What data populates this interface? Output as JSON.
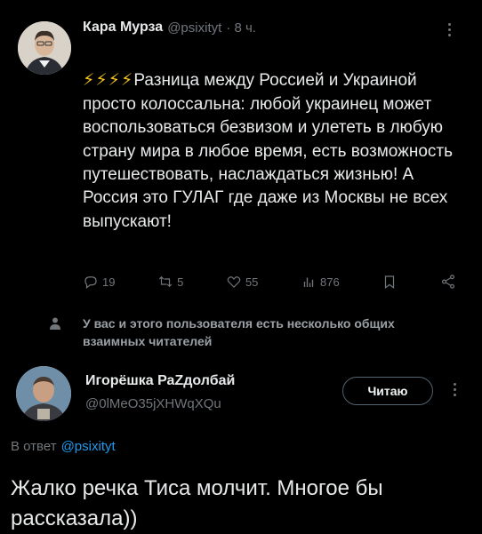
{
  "tweet": {
    "author_name": "Кара Мурза",
    "author_handle": "@psixityt",
    "time": "· 8 ч.",
    "lightning": "⚡⚡⚡⚡",
    "text": "Разница между Россией и Украиной просто колоссальна: любой украинец может воспользоваться безвизом и улететь в любую страну мира в любое время, есть возможность путешествовать, наслаждаться жизнью! А Россия это ГУЛАГ где даже из Москвы не всех выпускают!",
    "actions": {
      "replies": "19",
      "retweets": "5",
      "likes": "55",
      "views": "876"
    }
  },
  "mutual_notice": "У вас и этого пользователя есть несколько общих взаимных читателей",
  "user_card": {
    "name": "Игорёшка РаZдолбай",
    "handle": "@0lMeO35jXHWqXQu",
    "follow_label": "Читаю"
  },
  "reply": {
    "in_reply_prefix": "В ответ",
    "in_reply_handle": "@psixityt",
    "text": "Жалко речка Тиса молчит. Многое бы рассказала))"
  },
  "colors": {
    "background": "#000000",
    "text": "#e7e9ea",
    "muted": "#71767b",
    "link": "#1d9bf0",
    "lightning": "#f5c518"
  },
  "icons": [
    "reply-icon",
    "retweet-icon",
    "like-icon",
    "views-icon",
    "bookmark-icon",
    "share-icon",
    "more-icon",
    "mutual-people-icon"
  ]
}
